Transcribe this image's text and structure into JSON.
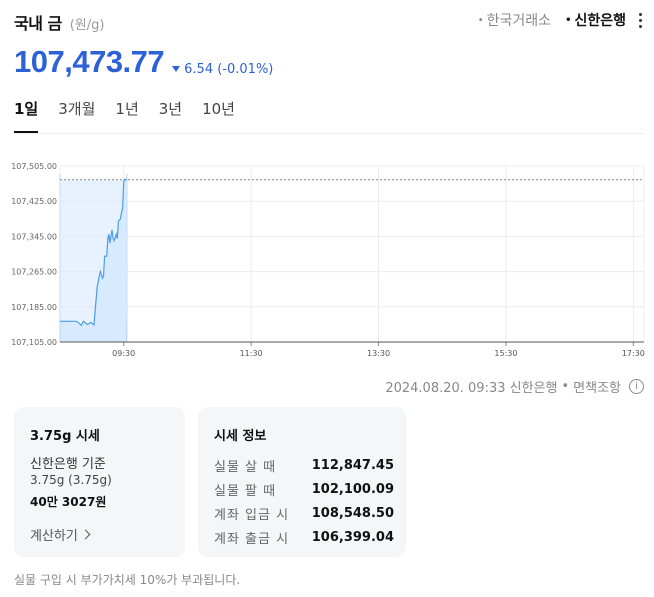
{
  "header": {
    "title": "국내 금",
    "unit": "(원/g)",
    "sources": [
      {
        "label": "한국거래소",
        "active": false
      },
      {
        "label": "신한은행",
        "active": true
      }
    ]
  },
  "price": {
    "value": "107,473.77",
    "change": "6.54 (-0.01%)",
    "direction": "down",
    "color": "#2c62d6"
  },
  "tabs": [
    "1일",
    "3개월",
    "1년",
    "3년",
    "10년"
  ],
  "chart_data": {
    "type": "area",
    "y_ticks": [
      "107,505.00",
      "107,425.00",
      "107,345.00",
      "107,265.00",
      "107,185.00",
      "107,105.00"
    ],
    "x_ticks": [
      "09:30",
      "11:30",
      "13:30",
      "15:30",
      "17:30"
    ],
    "ylim": [
      107105,
      107505
    ],
    "xlim": [
      "08:30",
      "17:40"
    ],
    "reference_line": 107473.77,
    "series": [
      {
        "x": [
          "08:30",
          "08:45",
          "08:47",
          "08:50",
          "08:52",
          "08:56",
          "08:59",
          "09:02",
          "09:05",
          "09:07",
          "09:08",
          "09:10",
          "09:11",
          "09:12",
          "09:14",
          "09:15",
          "09:16",
          "09:17",
          "09:19",
          "09:20",
          "09:21",
          "09:23",
          "09:24",
          "09:25",
          "09:27",
          "09:28",
          "09:29",
          "09:30",
          "09:31",
          "09:32",
          "09:33"
        ],
        "y": [
          107152,
          107152,
          107150,
          107143,
          107152,
          107145,
          107150,
          107144,
          107230,
          107255,
          107265,
          107250,
          107255,
          107300,
          107300,
          107340,
          107350,
          107330,
          107360,
          107340,
          107335,
          107350,
          107340,
          107380,
          107385,
          107400,
          107410,
          107470,
          107475,
          107474,
          107473.77
        ]
      }
    ],
    "colors": {
      "line": "#4a9de5",
      "fill": "#d8eaff"
    }
  },
  "timestamp": "2024.08.20. 09:33 신한은행",
  "disclaimer": "면책조항",
  "card1": {
    "title": "3.75g 시세",
    "basis": "신한은행 기준",
    "weight": "3.75g (3.75g)",
    "amount": "40만 3027원",
    "calc": "계산하기"
  },
  "card2": {
    "title": "시세 정보",
    "rows": [
      {
        "k": "실물 살 때",
        "v": "112,847.45"
      },
      {
        "k": "실물 팔 때",
        "v": "102,100.09"
      },
      {
        "k": "계좌 입금 시",
        "v": "108,548.50"
      },
      {
        "k": "계좌 출금 시",
        "v": "106,399.04"
      }
    ]
  },
  "note": "실물 구입 시 부가가치세 10%가 부과됩니다."
}
